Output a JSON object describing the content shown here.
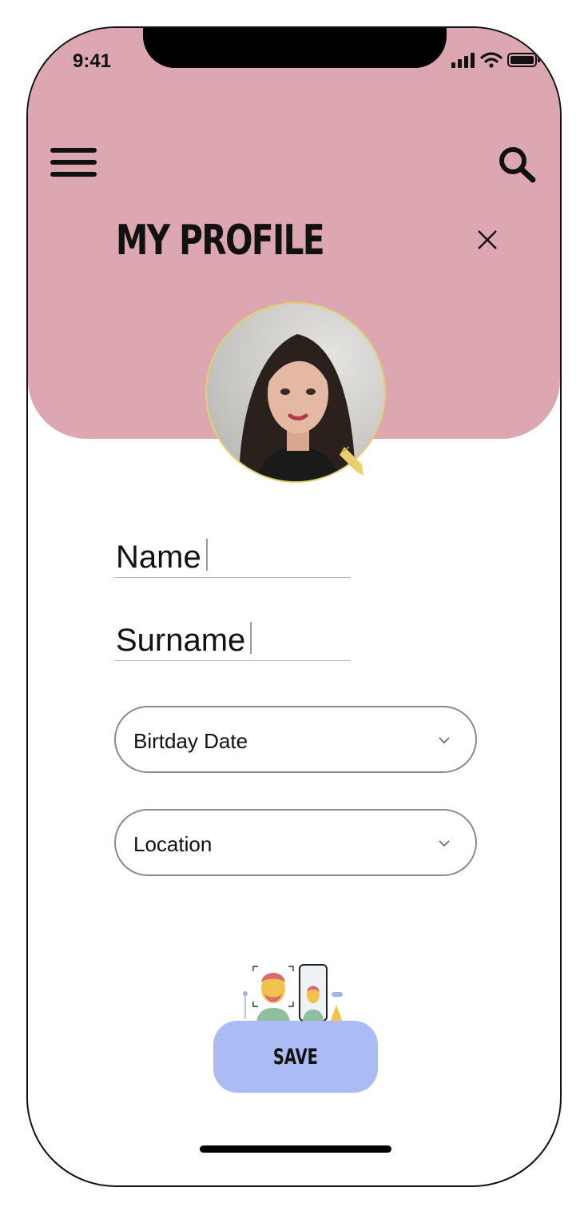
{
  "status_bar": {
    "time": "9:41"
  },
  "header": {
    "title": "MY PROFILE"
  },
  "form": {
    "name_label": "Name",
    "surname_label": "Surname",
    "birthday_label": "Birtday Date",
    "location_label": "Location"
  },
  "actions": {
    "save_label": "SAVE"
  },
  "icons": {
    "menu": "hamburger-menu-icon",
    "search": "search-icon",
    "close": "close-icon",
    "edit": "pencil-icon",
    "dropdown": "chevron-down-icon"
  },
  "colors": {
    "header_bg": "#dca7b0",
    "save_bg": "#abbcf4",
    "avatar_ring": "#e2cf6e",
    "pencil": "#e8cf6b"
  }
}
